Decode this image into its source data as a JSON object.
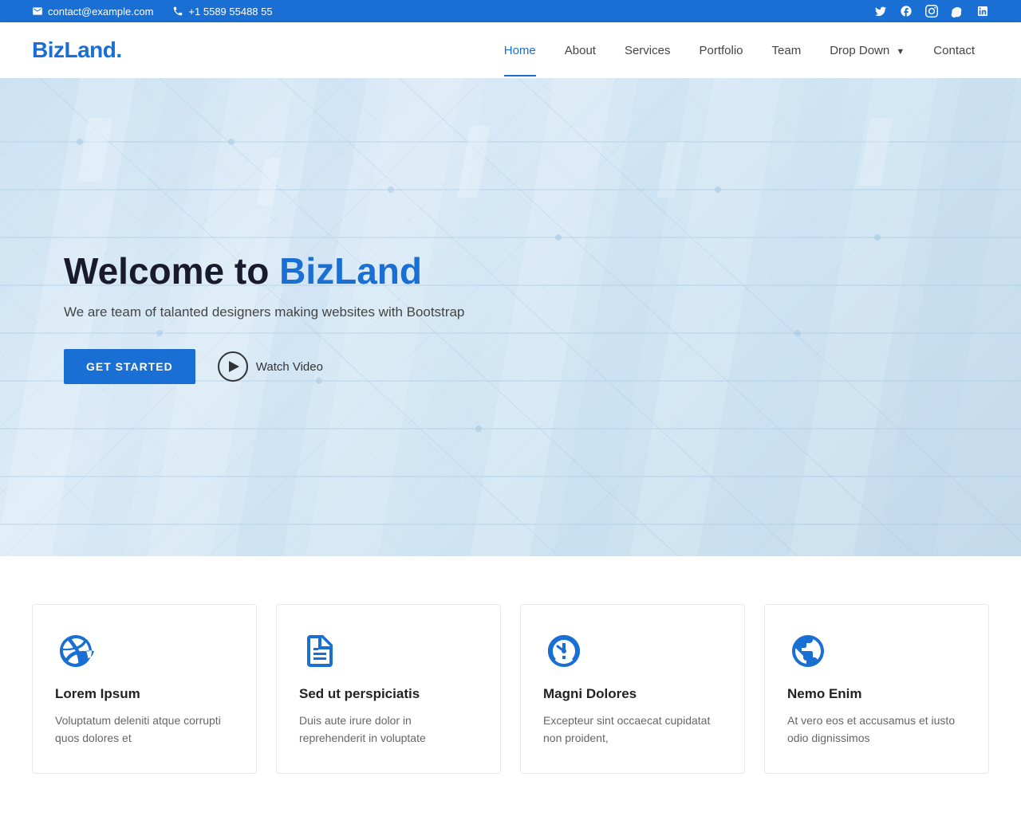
{
  "topbar": {
    "email": "contact@example.com",
    "phone": "+1 5589 55488 55",
    "social": [
      {
        "name": "twitter",
        "symbol": "𝕏"
      },
      {
        "name": "facebook",
        "symbol": "f"
      },
      {
        "name": "instagram",
        "symbol": "IG"
      },
      {
        "name": "skype",
        "symbol": "S"
      },
      {
        "name": "linkedin",
        "symbol": "in"
      }
    ]
  },
  "navbar": {
    "logo_text": "BizLand",
    "logo_dot": ".",
    "links": [
      {
        "label": "Home",
        "active": true
      },
      {
        "label": "About",
        "active": false
      },
      {
        "label": "Services",
        "active": false
      },
      {
        "label": "Portfolio",
        "active": false
      },
      {
        "label": "Team",
        "active": false
      },
      {
        "label": "Drop Down",
        "active": false,
        "has_dropdown": true
      },
      {
        "label": "Contact",
        "active": false
      }
    ]
  },
  "hero": {
    "title_prefix": "Welcome to ",
    "title_brand": "BizLand",
    "subtitle": "We are team of talanted designers making websites with Bootstrap",
    "cta_label": "GET STARTED",
    "watch_label": "Watch Video"
  },
  "features": [
    {
      "icon": "dribbble",
      "title": "Lorem Ipsum",
      "text": "Voluptatum deleniti atque corrupti quos dolores et"
    },
    {
      "icon": "document",
      "title": "Sed ut perspiciatis",
      "text": "Duis aute irure dolor in reprehenderit in voluptate"
    },
    {
      "icon": "speedometer",
      "title": "Magni Dolores",
      "text": "Excepteur sint occaecat cupidatat non proident,"
    },
    {
      "icon": "globe",
      "title": "Nemo Enim",
      "text": "At vero eos et accusamus et iusto odio dignissimos"
    }
  ]
}
